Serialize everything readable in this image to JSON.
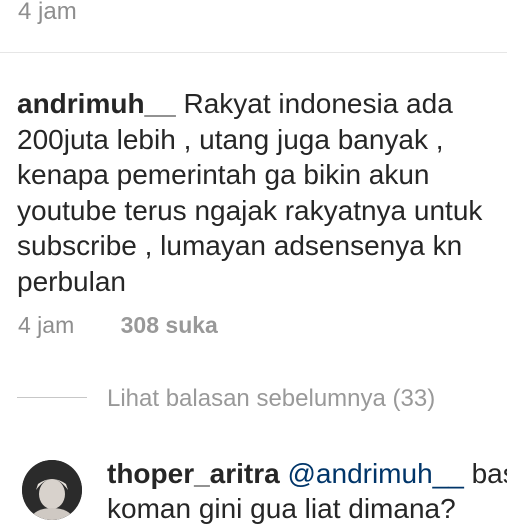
{
  "previous_comment": {
    "time": "4 jam"
  },
  "comment": {
    "username": "andrimuh__",
    "text": " Rakyat indonesia ada 200juta lebih , utang juga banyak , kenapa pemerintah ga bikin akun youtube terus ngajak rakyatnya untuk subscribe , lumayan adsensenya kn perbulan",
    "time": "4 jam",
    "likes": "308 suka"
  },
  "view_replies": {
    "label": "Lihat balasan sebelumnya (33)"
  },
  "reply": {
    "username": "thoper_aritra",
    "mention": "@andrimuh__",
    "text_line1": " bas",
    "text_line2": "koman gini gua liat dimana?"
  }
}
